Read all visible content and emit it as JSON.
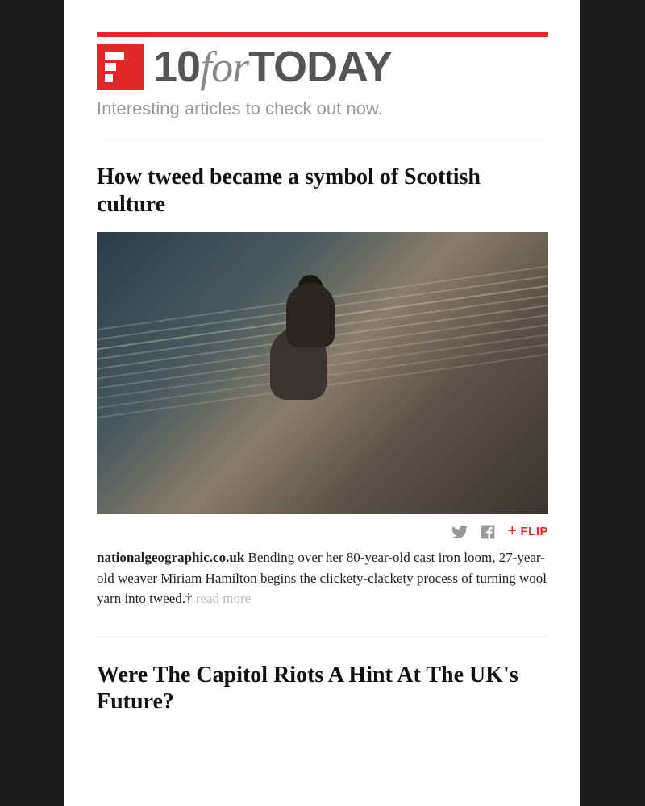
{
  "header": {
    "brand_num": "10",
    "brand_for": "for",
    "brand_today": "TODAY",
    "subtitle": "Interesting articles to check out now."
  },
  "share": {
    "flip_label": "FLIP"
  },
  "articles": [
    {
      "title": "How tweed became a symbol of Scottish culture",
      "source": "nationalgeographic.co.uk",
      "excerpt": "Bending over her 80-year-old cast iron loom, 27-year-old weaver Miriam Hamilton begins the clickety-clackety process of turning wool yarn into tweed.",
      "read_more": "read more"
    },
    {
      "title": "Were The Capitol Riots A Hint At The UK's Future?"
    }
  ]
}
